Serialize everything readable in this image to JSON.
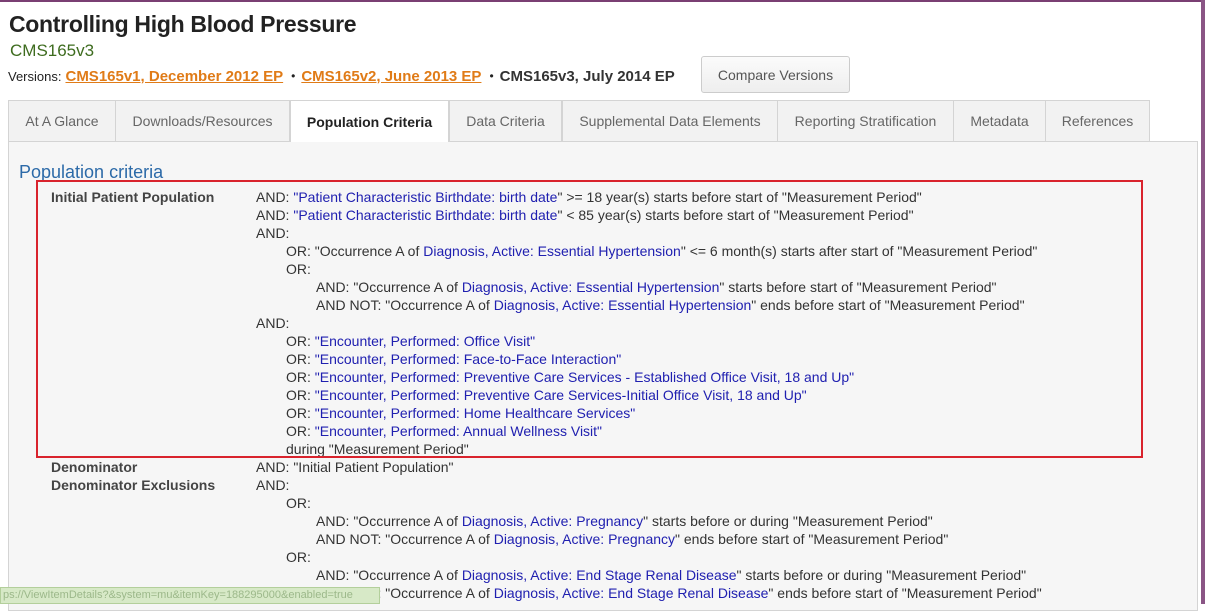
{
  "header": {
    "title": "Controlling High Blood Pressure",
    "subtitle": "CMS165v3",
    "versions_label": "Versions:",
    "version_links": [
      "CMS165v1, December 2012 EP",
      "CMS165v2, June 2013 EP"
    ],
    "current_version": "CMS165v3, July 2014 EP",
    "bullet": "•",
    "compare_button": "Compare Versions"
  },
  "tabs": [
    {
      "label": "At A Glance",
      "active": false
    },
    {
      "label": "Downloads/Resources",
      "active": false
    },
    {
      "label": "Population Criteria",
      "active": true
    },
    {
      "label": "Data Criteria",
      "active": false
    },
    {
      "label": "Supplemental Data Elements",
      "active": false
    },
    {
      "label": "Reporting Stratification",
      "active": false
    },
    {
      "label": "Metadata",
      "active": false
    },
    {
      "label": "References",
      "active": false
    }
  ],
  "section": {
    "heading": "Population criteria",
    "labels": {
      "initial_patient_population": "Initial Patient Population",
      "denominator": "Denominator",
      "denominator_exclusions": "Denominator Exclusions"
    },
    "ipp_lines": [
      {
        "indent": 0,
        "parts": [
          {
            "t": "AND: "
          },
          {
            "t": "\"Patient Characteristic Birthdate: birth date",
            "link": true
          },
          {
            "t": "\" >= 18 year(s) starts before start of \"Measurement Period\""
          }
        ]
      },
      {
        "indent": 0,
        "parts": [
          {
            "t": "AND: "
          },
          {
            "t": "\"Patient Characteristic Birthdate: birth date",
            "link": true
          },
          {
            "t": "\" < 85 year(s) starts before start of \"Measurement Period\""
          }
        ]
      },
      {
        "indent": 0,
        "parts": [
          {
            "t": "AND:"
          }
        ]
      },
      {
        "indent": 1,
        "parts": [
          {
            "t": "OR: \"Occurrence A of "
          },
          {
            "t": "Diagnosis, Active: Essential Hypertension",
            "link": true
          },
          {
            "t": "\" <= 6 month(s) starts after start of \"Measurement Period\""
          }
        ]
      },
      {
        "indent": 1,
        "parts": [
          {
            "t": "OR:"
          }
        ]
      },
      {
        "indent": 2,
        "parts": [
          {
            "t": "AND: \"Occurrence A of "
          },
          {
            "t": "Diagnosis, Active: Essential Hypertension",
            "link": true
          },
          {
            "t": "\" starts before start of \"Measurement Period\""
          }
        ]
      },
      {
        "indent": 2,
        "parts": [
          {
            "t": "AND NOT: \"Occurrence A of "
          },
          {
            "t": "Diagnosis, Active: Essential Hypertension",
            "link": true
          },
          {
            "t": "\" ends before start of \"Measurement Period\""
          }
        ]
      },
      {
        "indent": 0,
        "parts": [
          {
            "t": "AND:"
          }
        ]
      },
      {
        "indent": 1,
        "parts": [
          {
            "t": "OR: "
          },
          {
            "t": "\"Encounter, Performed: Office Visit\"",
            "link": true
          }
        ]
      },
      {
        "indent": 1,
        "parts": [
          {
            "t": "OR: "
          },
          {
            "t": "\"Encounter, Performed: Face-to-Face Interaction\"",
            "link": true
          }
        ]
      },
      {
        "indent": 1,
        "parts": [
          {
            "t": "OR: "
          },
          {
            "t": "\"Encounter, Performed: Preventive Care Services - Established Office Visit, 18 and Up\"",
            "link": true
          }
        ]
      },
      {
        "indent": 1,
        "parts": [
          {
            "t": "OR: "
          },
          {
            "t": "\"Encounter, Performed: Preventive Care Services-Initial Office Visit, 18 and Up\"",
            "link": true
          }
        ]
      },
      {
        "indent": 1,
        "parts": [
          {
            "t": "OR: "
          },
          {
            "t": "\"Encounter, Performed: Home Healthcare Services\"",
            "link": true
          }
        ]
      },
      {
        "indent": 1,
        "parts": [
          {
            "t": "OR: "
          },
          {
            "t": "\"Encounter, Performed: Annual Wellness Visit\"",
            "link": true
          }
        ]
      },
      {
        "indent": 1,
        "parts": [
          {
            "t": "during \"Measurement Period\""
          }
        ]
      }
    ],
    "denom_lines": [
      {
        "indent": 0,
        "parts": [
          {
            "t": "AND: \"Initial Patient Population\""
          }
        ]
      },
      {
        "indent": 0,
        "parts": [
          {
            "t": "AND:"
          }
        ]
      },
      {
        "indent": 1,
        "parts": [
          {
            "t": "OR:"
          }
        ]
      },
      {
        "indent": 2,
        "parts": [
          {
            "t": "AND: \"Occurrence A of "
          },
          {
            "t": "Diagnosis, Active: Pregnancy",
            "link": true
          },
          {
            "t": "\" starts before or during \"Measurement Period\""
          }
        ]
      },
      {
        "indent": 2,
        "parts": [
          {
            "t": "AND NOT: \"Occurrence A of "
          },
          {
            "t": "Diagnosis, Active: Pregnancy",
            "link": true
          },
          {
            "t": "\" ends before start of \"Measurement Period\""
          }
        ]
      },
      {
        "indent": 1,
        "parts": [
          {
            "t": "OR:"
          }
        ]
      },
      {
        "indent": 2,
        "parts": [
          {
            "t": "AND: \"Occurrence A of "
          },
          {
            "t": "Diagnosis, Active: End Stage Renal Disease",
            "link": true
          },
          {
            "t": "\" starts before or during \"Measurement Period\""
          }
        ]
      },
      {
        "indent": 2,
        "parts": [
          {
            "t": "AND NOT: \"Occurrence A of "
          },
          {
            "t": "Diagnosis, Active: End Stage Renal Disease",
            "link": true
          },
          {
            "t": "\" ends before start of \"Measurement Period\""
          }
        ]
      }
    ]
  },
  "status_url": "ps://ViewItemDetails?&system=mu&itemKey=188295000&enabled=true",
  "colors": {
    "accent_orange": "#e07b17",
    "subtitle_green": "#3e6c1f",
    "heading_blue": "#2c6aa8",
    "link_blue": "#2020b0",
    "highlight_red": "#d9232d"
  }
}
